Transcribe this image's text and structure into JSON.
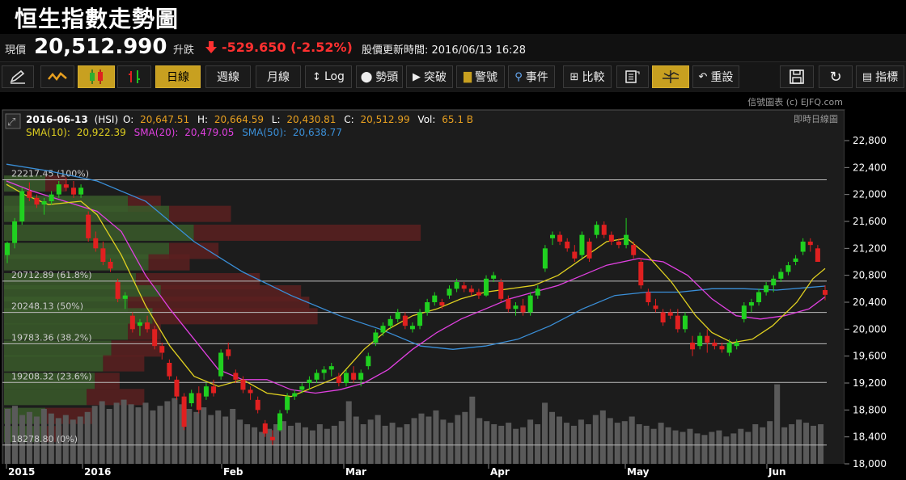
{
  "header": {
    "title": "恒生指數走勢圖"
  },
  "quote": {
    "price_label": "現價",
    "price": "20,512.990",
    "change_label": "升跌",
    "change": "-529.650 (-2.52%)",
    "update_label": "股價更新時間: 2016/06/13 16:28",
    "down_color": "#ff3030"
  },
  "toolbar": {
    "draw_icon": "pencil-icon",
    "line_icon": "line-chart-icon",
    "candle_icon": "candlestick-icon",
    "ohlc_icon": "ohlc-bar-icon",
    "daily": "日線",
    "weekly": "週線",
    "monthly": "月線",
    "log": "Log",
    "pattern": "勢頭",
    "breakout": "突破",
    "warning": "警號",
    "event": "事件",
    "compare": "比較",
    "reset": "重設",
    "indicators": "指標",
    "accent": "#c8a020"
  },
  "chart": {
    "credit": "信號圖表 (c) EJFQ.com",
    "realtime_label": "即時日線圖",
    "ohlc": {
      "date": "2016-06-13",
      "symbol": "(HSI)",
      "o_label": "O:",
      "o": "20,647.51",
      "h_label": "H:",
      "h": "20,664.59",
      "l_label": "L:",
      "l": "20,430.81",
      "c_label": "C:",
      "c": "20,512.99",
      "vol_label": "Vol:",
      "vol": "65.1 B"
    },
    "sma": {
      "sma10_label": "SMA(10):",
      "sma10": "20,922.39",
      "sma20_label": "SMA(20):",
      "sma20": "20,479.05",
      "sma50_label": "SMA(50):",
      "sma50": "20,638.77",
      "sma10_color": "#e0d020",
      "sma20_color": "#e040e0",
      "sma50_color": "#3a8fd8"
    },
    "fib_levels": [
      {
        "label": "22217.45 (100%)",
        "value": 22217.45
      },
      {
        "label": "20712.89 (61.8%)",
        "value": 20712.89
      },
      {
        "label": "20248.13 (50%)",
        "value": 20248.13
      },
      {
        "label": "19783.36 (38.2%)",
        "value": 19783.36
      },
      {
        "label": "19208.32 (23.6%)",
        "value": 19208.32
      },
      {
        "label": "18278.80 (0%)",
        "value": 18278.8
      }
    ],
    "y_ticks": [
      "22,800",
      "22,400",
      "22,000",
      "21,600",
      "21,200",
      "20,800",
      "20,400",
      "20,000",
      "19,600",
      "19,200",
      "18,800",
      "18,400",
      "18,000"
    ],
    "x_ticks": [
      "2015",
      "2016",
      "Feb",
      "Mar",
      "Apr",
      "May",
      "Jun"
    ],
    "up_color": "#20d020",
    "down_color": "#e02020"
  },
  "chart_data": {
    "type": "candlestick",
    "ylim": [
      18000,
      22900
    ],
    "volume_profile": [
      {
        "price": 22150,
        "bull": 0.1,
        "bear": 0.05
      },
      {
        "price": 21850,
        "bull": 0.3,
        "bear": 0.08
      },
      {
        "price": 21700,
        "bull": 0.4,
        "bear": 0.15
      },
      {
        "price": 21420,
        "bull": 0.46,
        "bear": 0.55
      },
      {
        "price": 21150,
        "bull": 0.4,
        "bear": 0.12
      },
      {
        "price": 20980,
        "bull": 0.35,
        "bear": 0.1
      },
      {
        "price": 20700,
        "bull": 0.32,
        "bear": 0.3
      },
      {
        "price": 20520,
        "bull": 0.38,
        "bear": 0.34
      },
      {
        "price": 20350,
        "bull": 0.3,
        "bear": 0.44
      },
      {
        "price": 20180,
        "bull": 0.36,
        "bear": 0.4
      },
      {
        "price": 19950,
        "bull": 0.3,
        "bear": 0.08
      },
      {
        "price": 19700,
        "bull": 0.26,
        "bear": 0.12
      },
      {
        "price": 19480,
        "bull": 0.24,
        "bear": 0.1
      },
      {
        "price": 19220,
        "bull": 0.22,
        "bear": 0.06
      },
      {
        "price": 18980,
        "bull": 0.2,
        "bear": 0.14
      },
      {
        "price": 18700,
        "bull": 0.1,
        "bear": 0.12
      },
      {
        "price": 18430,
        "bull": 0.1,
        "bear": 0.04
      }
    ],
    "candles": [
      [
        21100,
        21300,
        20980,
        21280
      ],
      [
        21280,
        21650,
        21200,
        21600
      ],
      [
        21600,
        22100,
        21550,
        22050
      ],
      [
        22050,
        22180,
        21900,
        21950
      ],
      [
        21950,
        22000,
        21800,
        21850
      ],
      [
        21850,
        21950,
        21700,
        21900
      ],
      [
        21900,
        22050,
        21850,
        22000
      ],
      [
        22000,
        22200,
        21950,
        22150
      ],
      [
        22150,
        22250,
        22050,
        22100
      ],
      [
        22100,
        22200,
        21950,
        22000
      ],
      [
        22000,
        22150,
        21950,
        22100
      ],
      [
        21700,
        21750,
        21300,
        21350
      ],
      [
        21350,
        21450,
        21150,
        21200
      ],
      [
        21200,
        21300,
        20950,
        21000
      ],
      [
        21000,
        21050,
        20850,
        20900
      ],
      [
        20700,
        20750,
        20400,
        20450
      ],
      [
        20450,
        20550,
        20300,
        20500
      ],
      [
        20200,
        20250,
        19950,
        20000
      ],
      [
        20050,
        20150,
        19900,
        20100
      ],
      [
        20100,
        20200,
        19950,
        20000
      ],
      [
        20000,
        20050,
        19700,
        19750
      ],
      [
        19750,
        19800,
        19550,
        19650
      ],
      [
        19500,
        19550,
        19250,
        19300
      ],
      [
        19250,
        19300,
        18950,
        19000
      ],
      [
        19000,
        19050,
        18500,
        18550
      ],
      [
        18900,
        19100,
        18850,
        19050
      ],
      [
        19050,
        19150,
        18750,
        18800
      ],
      [
        19000,
        19200,
        18950,
        19150
      ],
      [
        19150,
        19250,
        19000,
        19050
      ],
      [
        19300,
        19700,
        19250,
        19650
      ],
      [
        19700,
        19800,
        19550,
        19600
      ],
      [
        19350,
        19400,
        19200,
        19250
      ],
      [
        19250,
        19300,
        19050,
        19100
      ],
      [
        19100,
        19150,
        18950,
        19050
      ],
      [
        18950,
        19000,
        18750,
        18800
      ],
      [
        18600,
        18650,
        18400,
        18450
      ],
      [
        18400,
        18500,
        18280,
        18350
      ],
      [
        18500,
        18800,
        18480,
        18750
      ],
      [
        18800,
        19050,
        18750,
        19000
      ],
      [
        19000,
        19100,
        18950,
        19050
      ],
      [
        19100,
        19200,
        19050,
        19150
      ],
      [
        19200,
        19300,
        19100,
        19250
      ],
      [
        19250,
        19400,
        19200,
        19350
      ],
      [
        19350,
        19450,
        19250,
        19400
      ],
      [
        19400,
        19500,
        19300,
        19450
      ],
      [
        19300,
        19350,
        19150,
        19200
      ],
      [
        19200,
        19400,
        19150,
        19350
      ],
      [
        19350,
        19450,
        19200,
        19250
      ],
      [
        19250,
        19400,
        19150,
        19350
      ],
      [
        19450,
        19650,
        19400,
        19600
      ],
      [
        19800,
        20000,
        19750,
        19950
      ],
      [
        19950,
        20100,
        19900,
        20050
      ],
      [
        20050,
        20200,
        20000,
        20150
      ],
      [
        20150,
        20300,
        20100,
        20250
      ],
      [
        20200,
        20250,
        20000,
        20050
      ],
      [
        20000,
        20100,
        19950,
        20050
      ],
      [
        20050,
        20300,
        20000,
        20250
      ],
      [
        20250,
        20450,
        20200,
        20400
      ],
      [
        20400,
        20550,
        20350,
        20500
      ],
      [
        20400,
        20450,
        20300,
        20350
      ],
      [
        20500,
        20650,
        20450,
        20600
      ],
      [
        20600,
        20750,
        20550,
        20700
      ],
      [
        20650,
        20700,
        20550,
        20600
      ],
      [
        20600,
        20650,
        20500,
        20550
      ],
      [
        20550,
        20600,
        20450,
        20500
      ],
      [
        20500,
        20800,
        20480,
        20750
      ],
      [
        20750,
        20850,
        20700,
        20800
      ],
      [
        20700,
        20750,
        20400,
        20450
      ],
      [
        20450,
        20500,
        20250,
        20300
      ],
      [
        20300,
        20400,
        20200,
        20350
      ],
      [
        20350,
        20450,
        20200,
        20250
      ],
      [
        20250,
        20550,
        20200,
        20500
      ],
      [
        20500,
        20650,
        20450,
        20600
      ],
      [
        20900,
        21250,
        20850,
        21200
      ],
      [
        21350,
        21450,
        21250,
        21400
      ],
      [
        21400,
        21450,
        21250,
        21300
      ],
      [
        21300,
        21350,
        21150,
        21200
      ],
      [
        21150,
        21250,
        21000,
        21050
      ],
      [
        21100,
        21450,
        21050,
        21400
      ],
      [
        21300,
        21350,
        21000,
        21050
      ],
      [
        21400,
        21600,
        21350,
        21550
      ],
      [
        21550,
        21600,
        21350,
        21400
      ],
      [
        21400,
        21450,
        21250,
        21300
      ],
      [
        21300,
        21350,
        21200,
        21250
      ],
      [
        21250,
        21650,
        21200,
        21400
      ],
      [
        21250,
        21300,
        21050,
        21100
      ],
      [
        21000,
        21050,
        20600,
        20650
      ],
      [
        20550,
        20600,
        20350,
        20400
      ],
      [
        20350,
        20450,
        20250,
        20300
      ],
      [
        20250,
        20300,
        20050,
        20100
      ],
      [
        20250,
        20300,
        20150,
        20200
      ],
      [
        20200,
        20300,
        19950,
        20000
      ],
      [
        20000,
        20250,
        19950,
        20200
      ],
      [
        19800,
        19900,
        19600,
        19700
      ],
      [
        19750,
        19950,
        19700,
        19900
      ],
      [
        19900,
        20000,
        19650,
        19800
      ],
      [
        19800,
        19850,
        19700,
        19750
      ],
      [
        19750,
        19800,
        19650,
        19700
      ],
      [
        19650,
        19850,
        19600,
        19800
      ],
      [
        19750,
        19850,
        19700,
        19800
      ],
      [
        20150,
        20400,
        20100,
        20350
      ],
      [
        20350,
        20450,
        20250,
        20400
      ],
      [
        20400,
        20600,
        20350,
        20550
      ],
      [
        20550,
        20700,
        20500,
        20650
      ],
      [
        20650,
        20800,
        20550,
        20750
      ],
      [
        20750,
        20900,
        20700,
        20850
      ],
      [
        20850,
        21000,
        20800,
        20950
      ],
      [
        21000,
        21100,
        20950,
        21050
      ],
      [
        21150,
        21350,
        21100,
        21300
      ],
      [
        21300,
        21350,
        21150,
        21250
      ],
      [
        21200,
        21250,
        21000,
        21000
      ],
      [
        20580,
        20650,
        20430,
        20510
      ]
    ],
    "sma10": [
      [
        8,
        22150
      ],
      [
        30,
        22000
      ],
      [
        60,
        21850
      ],
      [
        100,
        21900
      ],
      [
        120,
        21700
      ],
      [
        150,
        21100
      ],
      [
        180,
        20350
      ],
      [
        210,
        19750
      ],
      [
        240,
        19300
      ],
      [
        270,
        19150
      ],
      [
        300,
        19250
      ],
      [
        330,
        19050
      ],
      [
        360,
        19000
      ],
      [
        390,
        19150
      ],
      [
        420,
        19300
      ],
      [
        450,
        19700
      ],
      [
        480,
        20000
      ],
      [
        510,
        20200
      ],
      [
        540,
        20300
      ],
      [
        570,
        20450
      ],
      [
        600,
        20550
      ],
      [
        630,
        20600
      ],
      [
        660,
        20650
      ],
      [
        690,
        20800
      ],
      [
        720,
        21050
      ],
      [
        750,
        21300
      ],
      [
        775,
        21350
      ],
      [
        800,
        21100
      ],
      [
        830,
        20700
      ],
      [
        860,
        20200
      ],
      [
        880,
        19950
      ],
      [
        905,
        19800
      ],
      [
        930,
        19850
      ],
      [
        955,
        20050
      ],
      [
        985,
        20400
      ],
      [
        1005,
        20750
      ],
      [
        1020,
        20900
      ]
    ],
    "sma20": [
      [
        8,
        22200
      ],
      [
        40,
        22050
      ],
      [
        80,
        21900
      ],
      [
        120,
        21750
      ],
      [
        150,
        21450
      ],
      [
        180,
        20800
      ],
      [
        210,
        20300
      ],
      [
        240,
        19850
      ],
      [
        270,
        19400
      ],
      [
        300,
        19250
      ],
      [
        330,
        19250
      ],
      [
        360,
        19100
      ],
      [
        390,
        19050
      ],
      [
        420,
        19100
      ],
      [
        450,
        19200
      ],
      [
        480,
        19400
      ],
      [
        510,
        19700
      ],
      [
        540,
        19950
      ],
      [
        570,
        20150
      ],
      [
        600,
        20300
      ],
      [
        630,
        20450
      ],
      [
        660,
        20550
      ],
      [
        690,
        20650
      ],
      [
        720,
        20800
      ],
      [
        750,
        20950
      ],
      [
        790,
        21050
      ],
      [
        820,
        21000
      ],
      [
        850,
        20800
      ],
      [
        880,
        20450
      ],
      [
        910,
        20200
      ],
      [
        940,
        20150
      ],
      [
        970,
        20200
      ],
      [
        1000,
        20300
      ],
      [
        1020,
        20480
      ]
    ],
    "sma50": [
      [
        8,
        22450
      ],
      [
        60,
        22350
      ],
      [
        120,
        22200
      ],
      [
        180,
        21900
      ],
      [
        240,
        21300
      ],
      [
        300,
        20850
      ],
      [
        360,
        20500
      ],
      [
        420,
        20200
      ],
      [
        470,
        20000
      ],
      [
        520,
        19750
      ],
      [
        560,
        19700
      ],
      [
        600,
        19750
      ],
      [
        640,
        19850
      ],
      [
        680,
        20050
      ],
      [
        720,
        20300
      ],
      [
        760,
        20500
      ],
      [
        800,
        20550
      ],
      [
        840,
        20550
      ],
      [
        880,
        20600
      ],
      [
        920,
        20600
      ],
      [
        960,
        20580
      ],
      [
        1000,
        20620
      ],
      [
        1020,
        20640
      ]
    ],
    "volume": [
      0.4,
      0.42,
      0.36,
      0.38,
      0.35,
      0.4,
      0.37,
      0.34,
      0.36,
      0.33,
      0.35,
      0.38,
      0.42,
      0.45,
      0.4,
      0.44,
      0.46,
      0.43,
      0.41,
      0.44,
      0.39,
      0.42,
      0.45,
      0.47,
      0.43,
      0.4,
      0.38,
      0.41,
      0.36,
      0.39,
      0.35,
      0.4,
      0.33,
      0.3,
      0.28,
      0.25,
      0.27,
      0.3,
      0.32,
      0.29,
      0.31,
      0.28,
      0.26,
      0.3,
      0.27,
      0.29,
      0.32,
      0.45,
      0.35,
      0.3,
      0.33,
      0.36,
      0.29,
      0.31,
      0.28,
      0.3,
      0.34,
      0.37,
      0.35,
      0.39,
      0.33,
      0.31,
      0.36,
      0.38,
      0.48,
      0.34,
      0.32,
      0.3,
      0.29,
      0.31,
      0.27,
      0.28,
      0.33,
      0.3,
      0.44,
      0.38,
      0.35,
      0.31,
      0.29,
      0.33,
      0.3,
      0.36,
      0.39,
      0.34,
      0.31,
      0.32,
      0.35,
      0.3,
      0.29,
      0.27,
      0.31,
      0.28,
      0.26,
      0.25,
      0.27,
      0.24,
      0.23,
      0.25,
      0.26,
      0.22,
      0.24,
      0.27,
      0.25,
      0.3,
      0.28,
      0.32,
      0.56,
      0.28,
      0.3,
      0.33,
      0.31,
      0.29,
      0.3
    ]
  }
}
